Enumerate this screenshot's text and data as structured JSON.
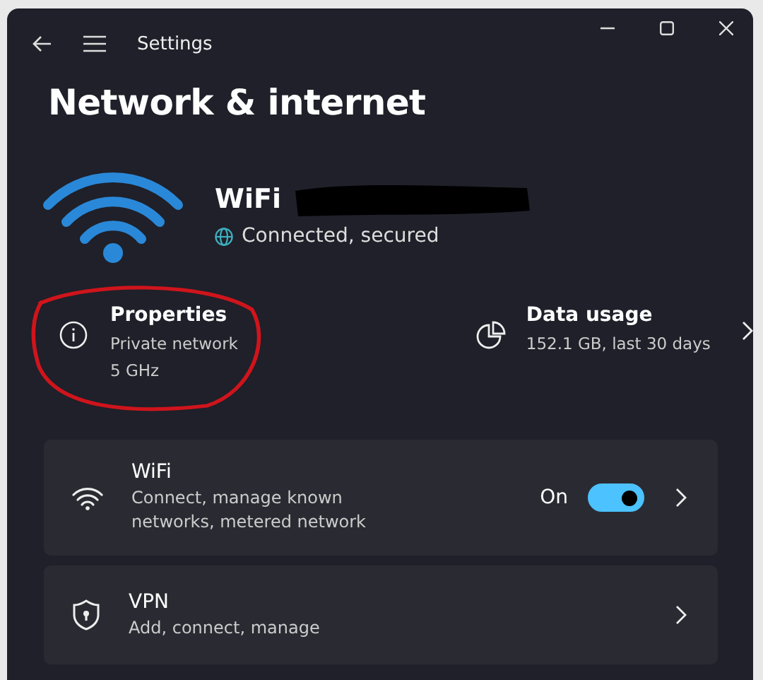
{
  "window": {
    "title": "Settings"
  },
  "page_title": "Network & internet",
  "network": {
    "name": "WiFi",
    "status": "Connected, secured"
  },
  "properties": {
    "title": "Properties",
    "lines": [
      "Private network",
      "5 GHz"
    ]
  },
  "data_usage": {
    "title": "Data usage",
    "detail": "152.1 GB, last 30 days"
  },
  "settings": [
    {
      "kind": "toggle",
      "title": "WiFi",
      "description": "Connect, manage known networks, metered network",
      "toggle_label": "On",
      "on": true
    },
    {
      "kind": "link",
      "title": "VPN",
      "description": "Add, connect, manage"
    }
  ]
}
